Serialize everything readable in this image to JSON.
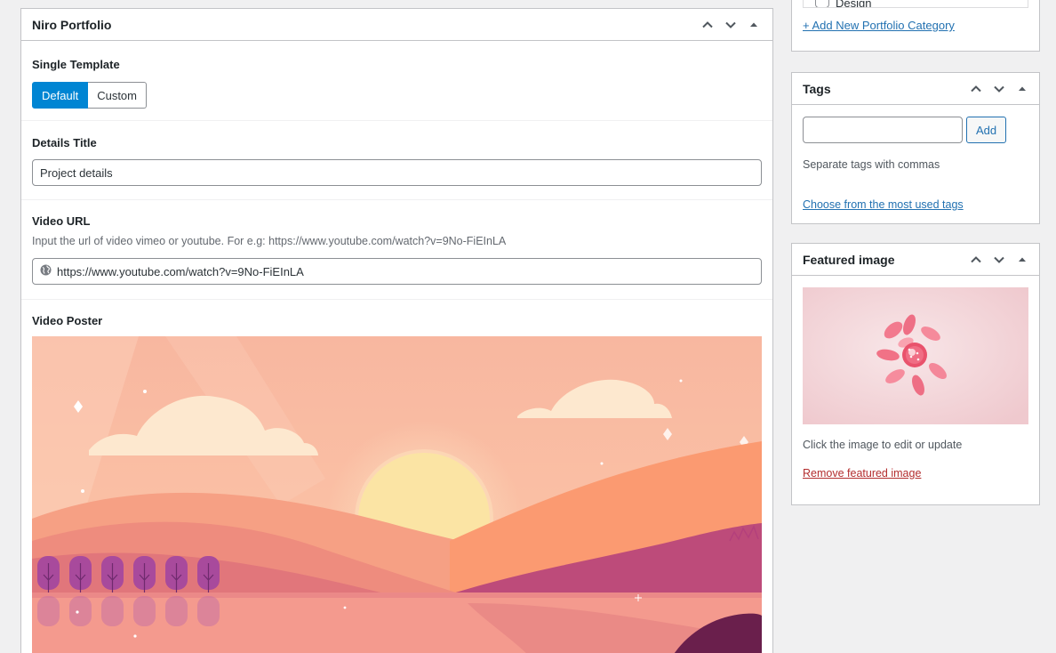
{
  "main": {
    "title": "Niro Portfolio",
    "single_template": {
      "label": "Single Template",
      "options": [
        "Default",
        "Custom"
      ],
      "selected": "Default"
    },
    "details_title": {
      "label": "Details Title",
      "value": "Project details"
    },
    "video_url": {
      "label": "Video URL",
      "description": "Input the url of video vimeo or youtube. For e.g: https://www.youtube.com/watch?v=9No-FiEInLA",
      "value": "https://www.youtube.com/watch?v=9No-FiEInLA"
    },
    "video_poster": {
      "label": "Video Poster"
    }
  },
  "categories": {
    "partial_item": "Design",
    "add_link": "+ Add New Portfolio Category"
  },
  "tags": {
    "title": "Tags",
    "input_value": "",
    "add_button": "Add",
    "hint": "Separate tags with commas",
    "choose_link": "Choose from the most used tags"
  },
  "featured_image": {
    "title": "Featured image",
    "hint": "Click the image to edit or update",
    "remove_link": "Remove featured image"
  },
  "colors": {
    "accent": "#0085d3",
    "link": "#2271b1",
    "danger_link": "#b32d2e"
  }
}
